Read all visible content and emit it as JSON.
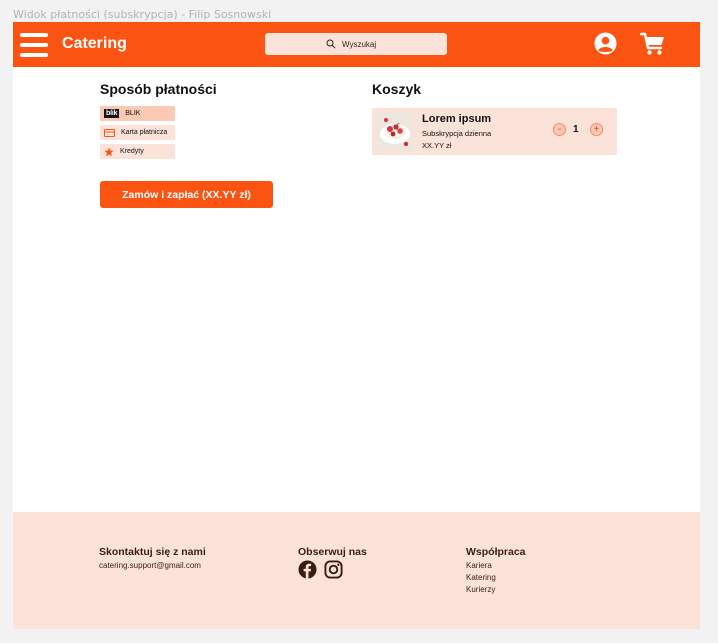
{
  "frame_title": "Widok płatności (subskrypcja) - Filip Sosnowski",
  "header": {
    "brand": "Catering",
    "search_placeholder": "Wyszukaj",
    "account_icon": "account-circle-icon",
    "cart_icon": "shopping-cart-icon",
    "menu_icon": "hamburger-menu-icon",
    "background_color": "#fb5412"
  },
  "payment": {
    "title": "Sposób płatności",
    "options": [
      {
        "logo": "blik",
        "label": "BLIK",
        "selected": true
      },
      {
        "icon": "credit-card-icon",
        "label": "Karta płatnicza",
        "selected": false
      },
      {
        "icon": "star-icon",
        "label": "Kredyty",
        "selected": false
      }
    ],
    "order_button": "Zamów i zapłać (XX.YY zł)"
  },
  "cart": {
    "title": "Koszyk",
    "items": [
      {
        "name": "Lorem ipsum",
        "subtitle": "Subskrypcja dzienna",
        "price": "XX.YY zł",
        "quantity": "1",
        "minus": "-",
        "plus": "+"
      }
    ]
  },
  "footer": {
    "contact_title": "Skontaktuj się z nami",
    "contact_email": "catering.support@gmail.com",
    "follow_title": "Obserwuj nas",
    "social_icons": [
      "facebook-icon",
      "instagram-icon"
    ],
    "cooperation_title": "Współpraca",
    "cooperation_links": [
      "Kariera",
      "Katering",
      "Kurierzy"
    ]
  },
  "colors": {
    "accent": "#fb5412",
    "light_accent": "#fce3da",
    "selected_option": "#fcc9b5"
  }
}
